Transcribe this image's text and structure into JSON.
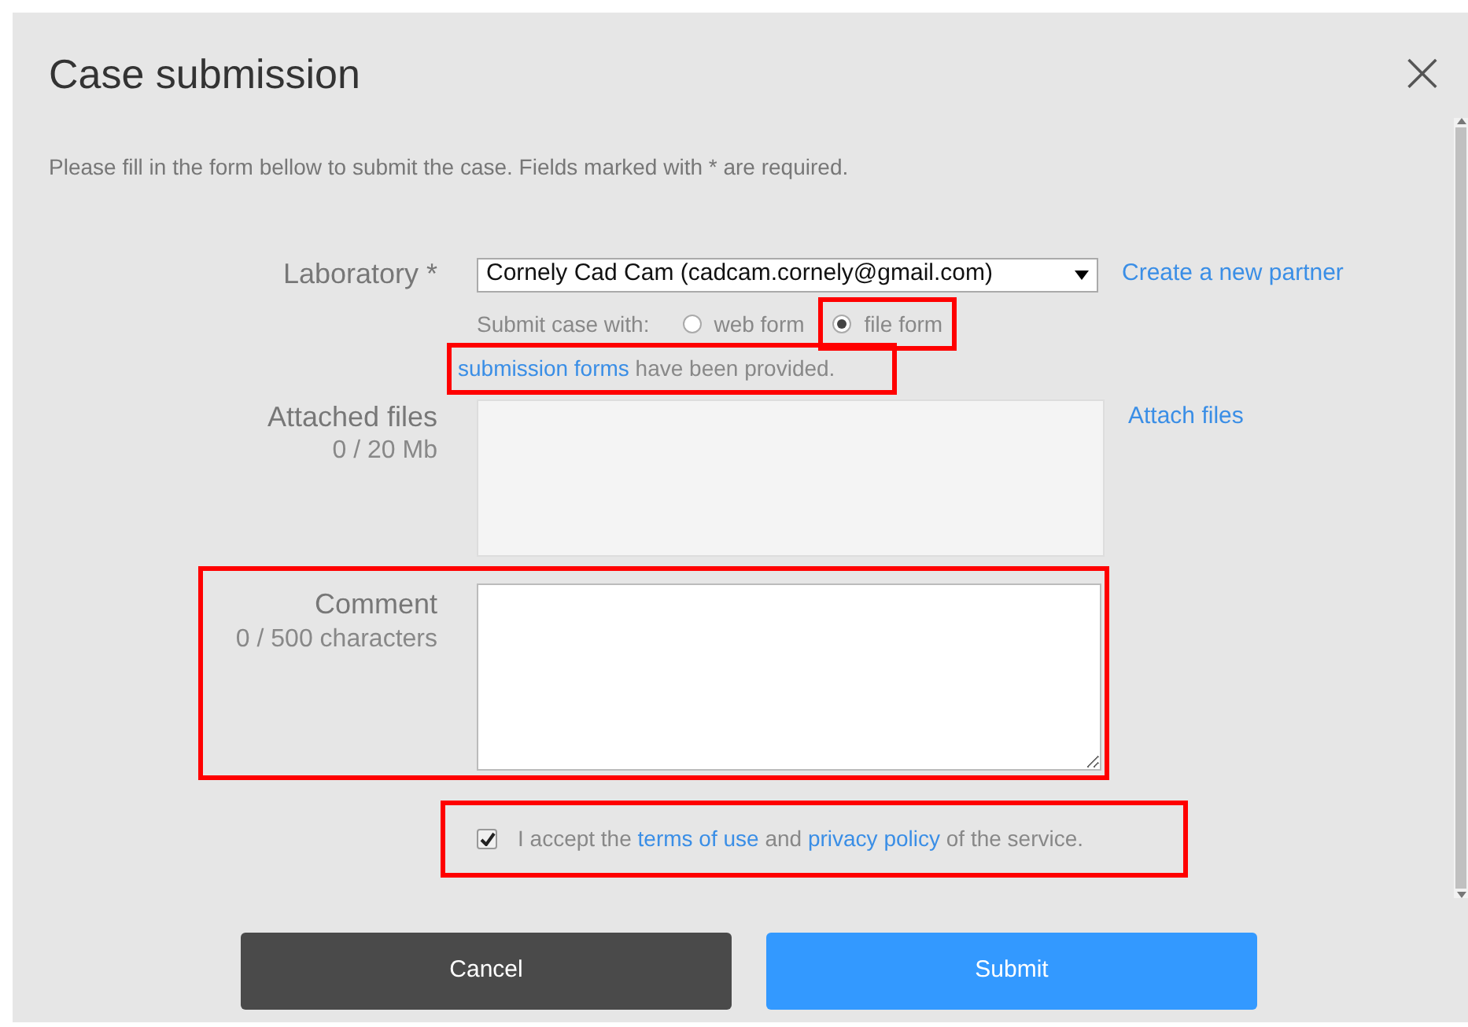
{
  "dialog": {
    "title": "Case submission",
    "close": "×",
    "intro": "Please fill in the form bellow to submit the case. Fields marked with * are required."
  },
  "laboratory": {
    "label": "Laboratory *",
    "value": "Cornely Cad Cam (cadcam.cornely@gmail.com)",
    "link": "Create a new partner"
  },
  "submit_with": {
    "label": "Submit case with:",
    "options": [
      {
        "label": "web form",
        "selected": false,
        "highlighted": false
      },
      {
        "label": "file form",
        "selected": true,
        "highlighted": true
      }
    ]
  },
  "notice": {
    "link": "submission forms",
    "rest": "have been provided.",
    "highlighted": true
  },
  "attached_files": {
    "label": "Attached files",
    "size": "0 / 20 Mb",
    "link": "Attach files"
  },
  "comment": {
    "label": "Comment",
    "count": "0 / 500 characters",
    "highlighted": true
  },
  "terms": {
    "checked": true,
    "highlighted": true,
    "parts": [
      {
        "kind": "text",
        "text": "I accept the"
      },
      {
        "kind": "link",
        "text": "terms of use"
      },
      {
        "kind": "text",
        "text": "and"
      },
      {
        "kind": "link",
        "text": "privacy policy"
      },
      {
        "kind": "text",
        "text": "of the service."
      }
    ]
  },
  "buttons": [
    {
      "label": "Cancel",
      "kind": "secondary"
    },
    {
      "label": "Submit",
      "kind": "primary"
    }
  ]
}
